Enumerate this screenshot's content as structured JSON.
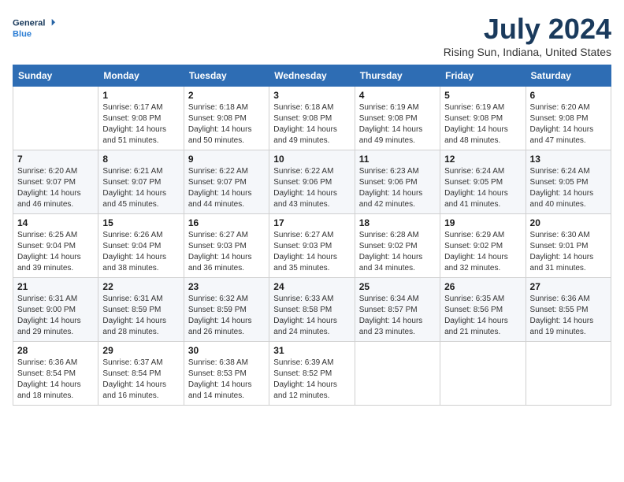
{
  "logo": {
    "line1": "General",
    "line2": "Blue"
  },
  "title": "July 2024",
  "location": "Rising Sun, Indiana, United States",
  "days_of_week": [
    "Sunday",
    "Monday",
    "Tuesday",
    "Wednesday",
    "Thursday",
    "Friday",
    "Saturday"
  ],
  "weeks": [
    [
      {
        "day": "",
        "info": ""
      },
      {
        "day": "1",
        "info": "Sunrise: 6:17 AM\nSunset: 9:08 PM\nDaylight: 14 hours\nand 51 minutes."
      },
      {
        "day": "2",
        "info": "Sunrise: 6:18 AM\nSunset: 9:08 PM\nDaylight: 14 hours\nand 50 minutes."
      },
      {
        "day": "3",
        "info": "Sunrise: 6:18 AM\nSunset: 9:08 PM\nDaylight: 14 hours\nand 49 minutes."
      },
      {
        "day": "4",
        "info": "Sunrise: 6:19 AM\nSunset: 9:08 PM\nDaylight: 14 hours\nand 49 minutes."
      },
      {
        "day": "5",
        "info": "Sunrise: 6:19 AM\nSunset: 9:08 PM\nDaylight: 14 hours\nand 48 minutes."
      },
      {
        "day": "6",
        "info": "Sunrise: 6:20 AM\nSunset: 9:08 PM\nDaylight: 14 hours\nand 47 minutes."
      }
    ],
    [
      {
        "day": "7",
        "info": "Sunrise: 6:20 AM\nSunset: 9:07 PM\nDaylight: 14 hours\nand 46 minutes."
      },
      {
        "day": "8",
        "info": "Sunrise: 6:21 AM\nSunset: 9:07 PM\nDaylight: 14 hours\nand 45 minutes."
      },
      {
        "day": "9",
        "info": "Sunrise: 6:22 AM\nSunset: 9:07 PM\nDaylight: 14 hours\nand 44 minutes."
      },
      {
        "day": "10",
        "info": "Sunrise: 6:22 AM\nSunset: 9:06 PM\nDaylight: 14 hours\nand 43 minutes."
      },
      {
        "day": "11",
        "info": "Sunrise: 6:23 AM\nSunset: 9:06 PM\nDaylight: 14 hours\nand 42 minutes."
      },
      {
        "day": "12",
        "info": "Sunrise: 6:24 AM\nSunset: 9:05 PM\nDaylight: 14 hours\nand 41 minutes."
      },
      {
        "day": "13",
        "info": "Sunrise: 6:24 AM\nSunset: 9:05 PM\nDaylight: 14 hours\nand 40 minutes."
      }
    ],
    [
      {
        "day": "14",
        "info": "Sunrise: 6:25 AM\nSunset: 9:04 PM\nDaylight: 14 hours\nand 39 minutes."
      },
      {
        "day": "15",
        "info": "Sunrise: 6:26 AM\nSunset: 9:04 PM\nDaylight: 14 hours\nand 38 minutes."
      },
      {
        "day": "16",
        "info": "Sunrise: 6:27 AM\nSunset: 9:03 PM\nDaylight: 14 hours\nand 36 minutes."
      },
      {
        "day": "17",
        "info": "Sunrise: 6:27 AM\nSunset: 9:03 PM\nDaylight: 14 hours\nand 35 minutes."
      },
      {
        "day": "18",
        "info": "Sunrise: 6:28 AM\nSunset: 9:02 PM\nDaylight: 14 hours\nand 34 minutes."
      },
      {
        "day": "19",
        "info": "Sunrise: 6:29 AM\nSunset: 9:02 PM\nDaylight: 14 hours\nand 32 minutes."
      },
      {
        "day": "20",
        "info": "Sunrise: 6:30 AM\nSunset: 9:01 PM\nDaylight: 14 hours\nand 31 minutes."
      }
    ],
    [
      {
        "day": "21",
        "info": "Sunrise: 6:31 AM\nSunset: 9:00 PM\nDaylight: 14 hours\nand 29 minutes."
      },
      {
        "day": "22",
        "info": "Sunrise: 6:31 AM\nSunset: 8:59 PM\nDaylight: 14 hours\nand 28 minutes."
      },
      {
        "day": "23",
        "info": "Sunrise: 6:32 AM\nSunset: 8:59 PM\nDaylight: 14 hours\nand 26 minutes."
      },
      {
        "day": "24",
        "info": "Sunrise: 6:33 AM\nSunset: 8:58 PM\nDaylight: 14 hours\nand 24 minutes."
      },
      {
        "day": "25",
        "info": "Sunrise: 6:34 AM\nSunset: 8:57 PM\nDaylight: 14 hours\nand 23 minutes."
      },
      {
        "day": "26",
        "info": "Sunrise: 6:35 AM\nSunset: 8:56 PM\nDaylight: 14 hours\nand 21 minutes."
      },
      {
        "day": "27",
        "info": "Sunrise: 6:36 AM\nSunset: 8:55 PM\nDaylight: 14 hours\nand 19 minutes."
      }
    ],
    [
      {
        "day": "28",
        "info": "Sunrise: 6:36 AM\nSunset: 8:54 PM\nDaylight: 14 hours\nand 18 minutes."
      },
      {
        "day": "29",
        "info": "Sunrise: 6:37 AM\nSunset: 8:54 PM\nDaylight: 14 hours\nand 16 minutes."
      },
      {
        "day": "30",
        "info": "Sunrise: 6:38 AM\nSunset: 8:53 PM\nDaylight: 14 hours\nand 14 minutes."
      },
      {
        "day": "31",
        "info": "Sunrise: 6:39 AM\nSunset: 8:52 PM\nDaylight: 14 hours\nand 12 minutes."
      },
      {
        "day": "",
        "info": ""
      },
      {
        "day": "",
        "info": ""
      },
      {
        "day": "",
        "info": ""
      }
    ]
  ]
}
